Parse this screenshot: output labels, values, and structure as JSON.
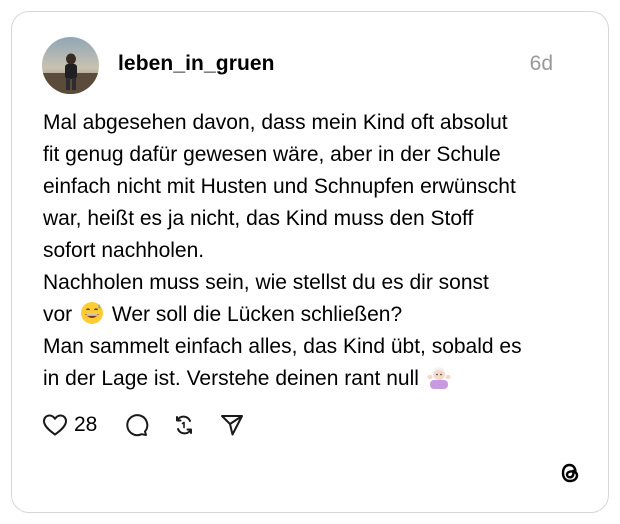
{
  "post": {
    "username": "leben_in_gruen",
    "timestamp": "6d",
    "body_lines": [
      "Mal abgesehen davon, dass mein Kind oft absolut",
      "fit genug dafür gewesen wäre, aber in der Schule",
      "einfach nicht mit Husten und Schnupfen erwünscht",
      "war, heißt es ja nicht, das Kind muss den Stoff",
      "sofort nachholen.",
      "Nachholen muss sein, wie stellst du es dir sonst",
      "vor",
      "Wer soll die Lücken schließen?",
      "Man sammelt einfach alles, das Kind übt, sobald es",
      "in der Lage ist. Verstehe deinen rant null"
    ],
    "emojis": [
      "grinning-sweat-emoji",
      "shrugging-woman-emoji"
    ]
  },
  "actions": {
    "like_count": "28",
    "icons": [
      "heart-icon",
      "comment-icon",
      "repost-icon",
      "share-icon"
    ]
  },
  "branding": {
    "logo": "threads-logo-icon"
  }
}
